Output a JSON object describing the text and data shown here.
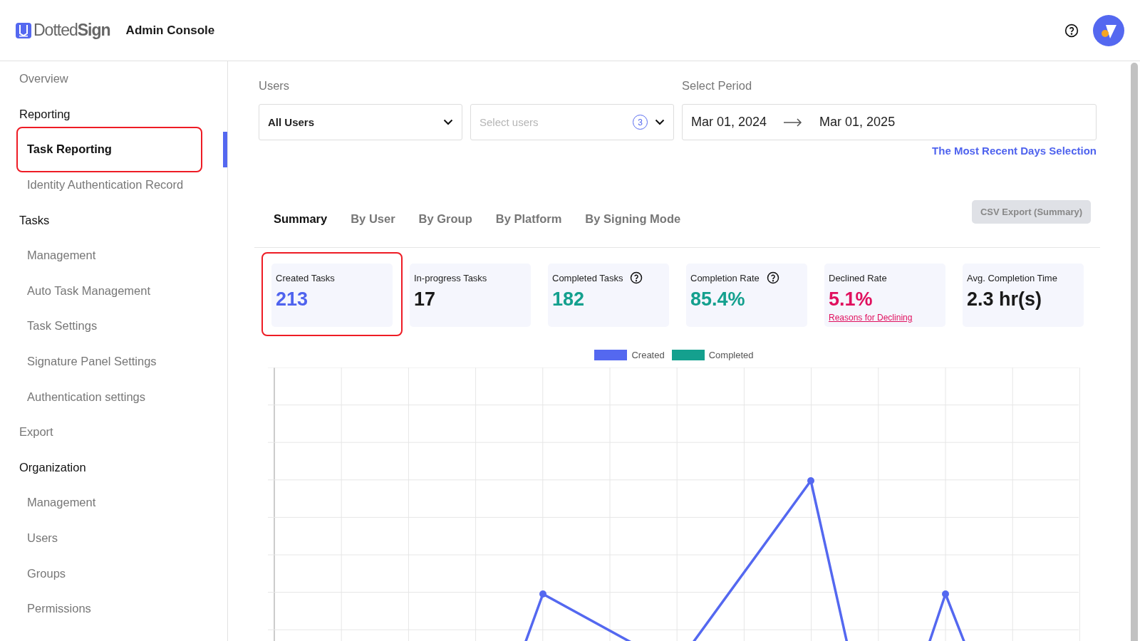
{
  "header": {
    "logo": "Dotted**Sign**",
    "title": "Admin Console"
  },
  "sidebar": {
    "items": [
      {
        "label": "Overview",
        "kind": "link",
        "selected": false
      },
      {
        "label": "Reporting",
        "kind": "section",
        "children": [
          {
            "label": "Task Reporting",
            "selected": true,
            "annotated": true
          },
          {
            "label": "Identity Authentication Record",
            "selected": false,
            "annotated": false
          }
        ]
      },
      {
        "label": "Tasks",
        "kind": "section",
        "children": [
          {
            "label": "Management",
            "selected": false,
            "annotated": false
          },
          {
            "label": "Auto Task Management",
            "selected": false,
            "annotated": false
          },
          {
            "label": "Task Settings",
            "selected": false,
            "annotated": false
          },
          {
            "label": "Signature Panel Settings",
            "selected": false,
            "annotated": false
          },
          {
            "label": "Authentication settings",
            "selected": false,
            "annotated": false
          }
        ]
      },
      {
        "label": "Export",
        "kind": "link",
        "selected": false
      },
      {
        "label": "Organization",
        "kind": "section",
        "children": [
          {
            "label": "Management",
            "selected": false,
            "annotated": false
          },
          {
            "label": "Users",
            "selected": false,
            "annotated": false
          },
          {
            "label": "Groups",
            "selected": false,
            "annotated": false
          },
          {
            "label": "Permissions",
            "selected": false,
            "annotated": false
          }
        ]
      }
    ]
  },
  "filters": {
    "users_label": "Users",
    "users_scope": "All Users",
    "users_placeholder": "Select users",
    "users_count": "3",
    "period_label": "Select Period",
    "start": "Mar 01, 2024",
    "end": "Mar 01, 2025",
    "recent_link": "The Most Recent Days Selection"
  },
  "tabs": [
    {
      "label": "Summary",
      "selected": true
    },
    {
      "label": "By User",
      "selected": false
    },
    {
      "label": "By Group",
      "selected": false
    },
    {
      "label": "By Platform",
      "selected": false
    },
    {
      "label": "By Signing Mode",
      "selected": false
    }
  ],
  "export_button": {
    "label": "CSV Export (Summary)",
    "disabled": true
  },
  "cards": [
    {
      "label": "Created Tasks",
      "value": "213",
      "color": "#4f63ee",
      "help": false,
      "annotated": true
    },
    {
      "label": "In-progress Tasks",
      "value": "17",
      "color": "#1a1a1a",
      "help": false,
      "annotated": false
    },
    {
      "label": "Completed Tasks",
      "value": "182",
      "color": "#14a08e",
      "help": true,
      "annotated": false
    },
    {
      "label": "Completion Rate",
      "value": "85.4%",
      "color": "#14a08e",
      "help": true,
      "annotated": false
    },
    {
      "label": "Declined Rate",
      "value": "5.1%",
      "color": "#e0105e",
      "help": false,
      "annotated": false,
      "link": "Reasons for Declining"
    },
    {
      "label": "Avg. Completion Time",
      "value": "2.3 hr(s)",
      "color": "#1a1a1a",
      "help": false,
      "annotated": false
    }
  ],
  "chart": {
    "legend": [
      {
        "label": "Created",
        "color": "#5468f0"
      },
      {
        "label": "Completed",
        "color": "#14a08e"
      }
    ]
  }
}
